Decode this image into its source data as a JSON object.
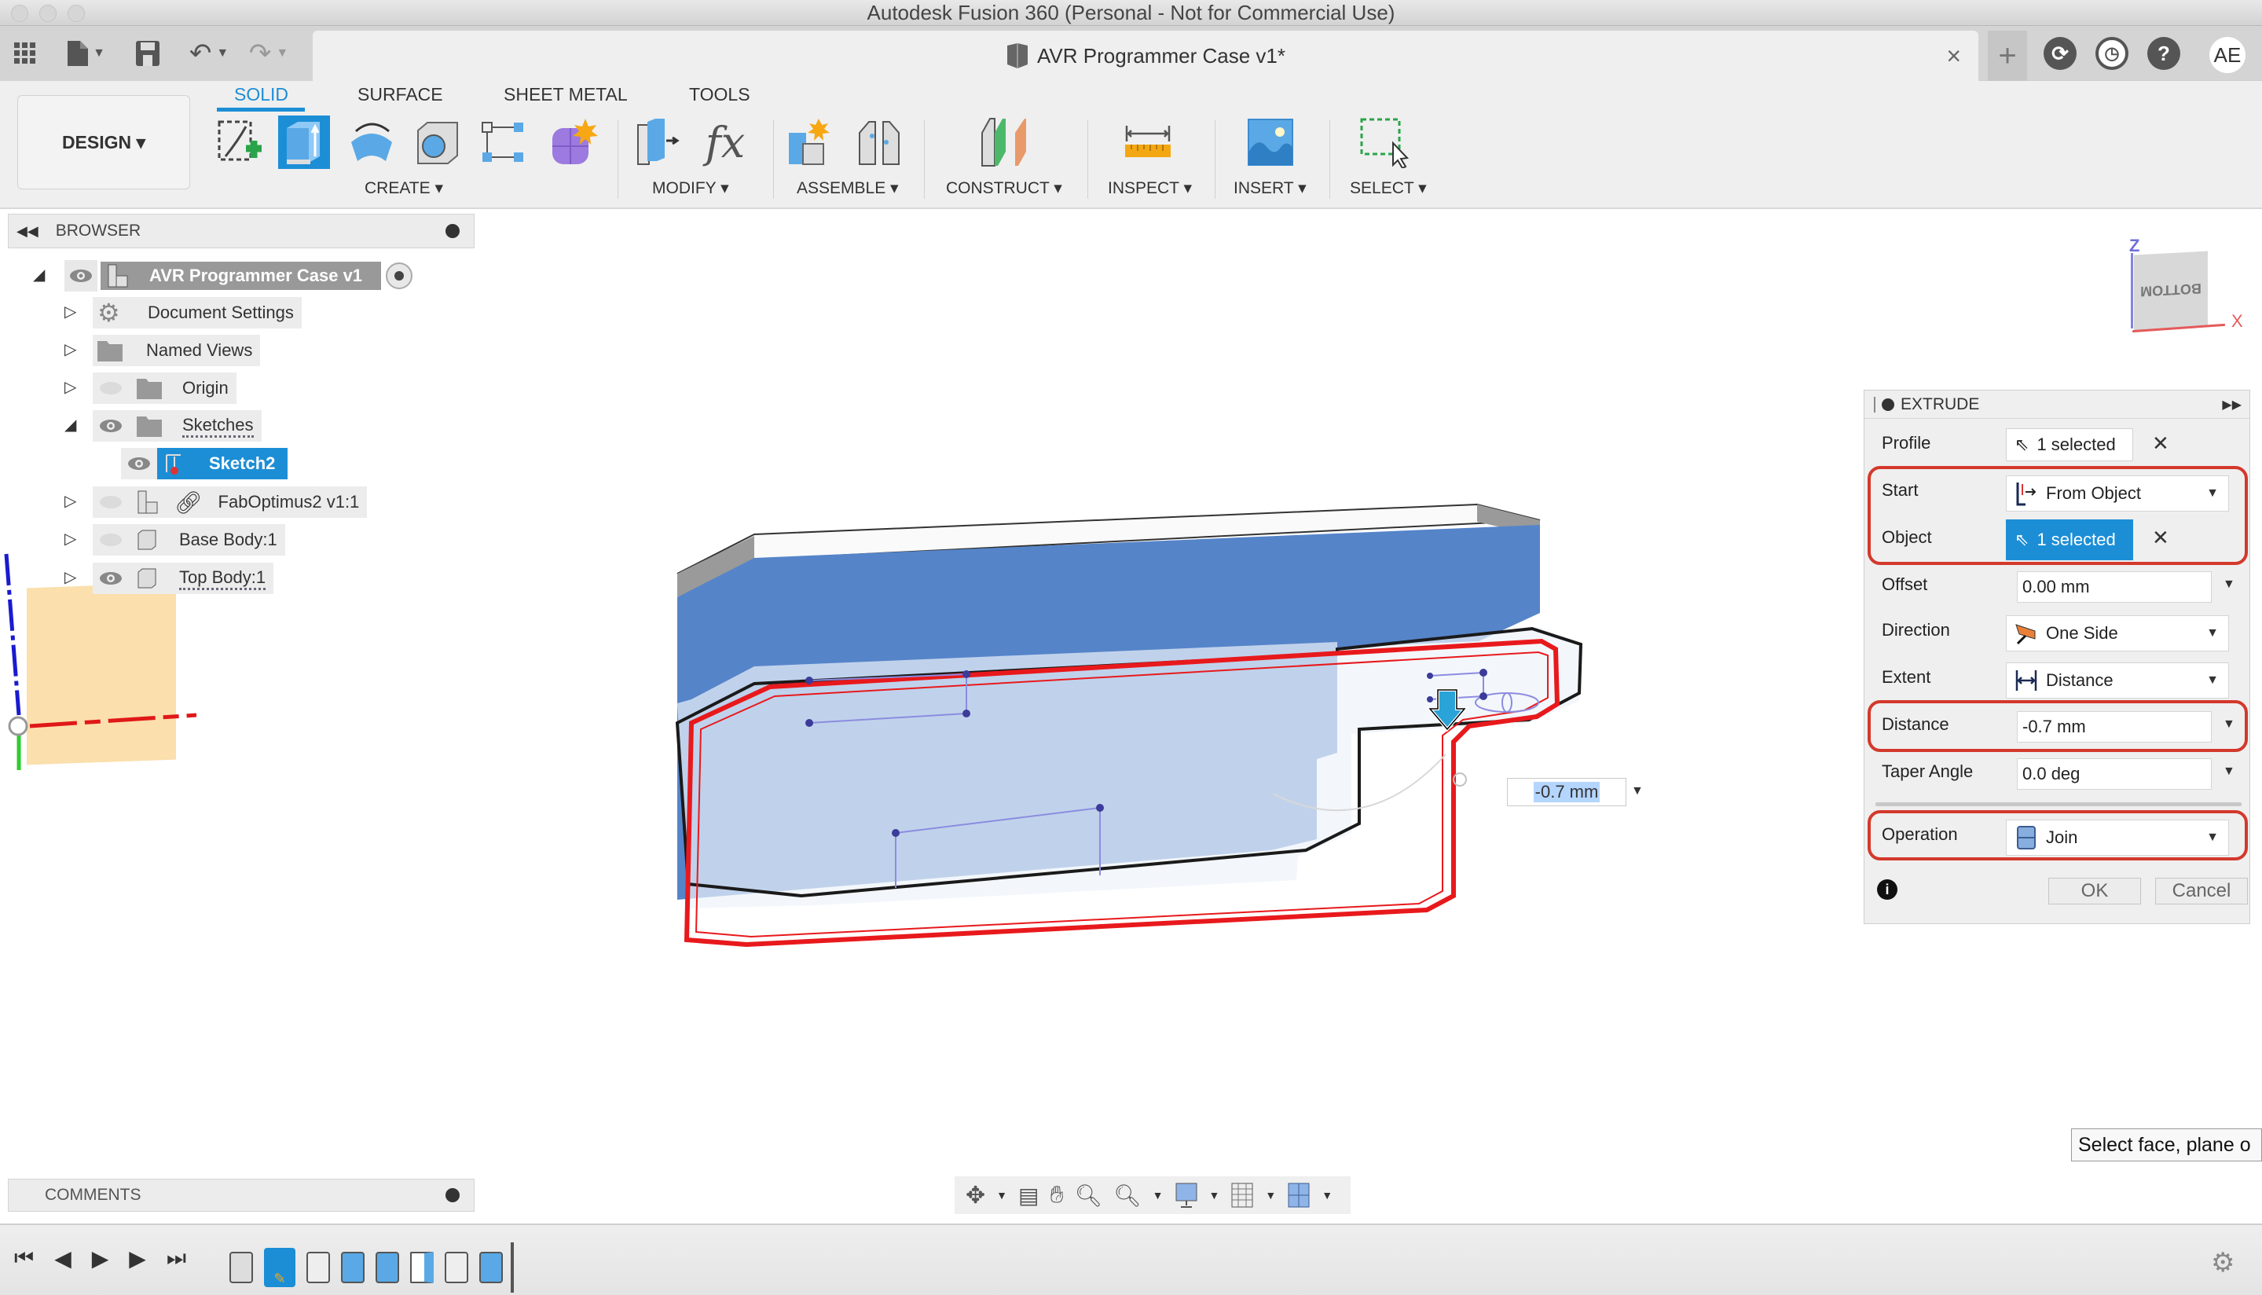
{
  "app": {
    "window_title": "Autodesk Fusion 360 (Personal - Not for Commercial Use)",
    "document_tab": "AVR Programmer Case v1*",
    "user_initials": "AE"
  },
  "quick_access": {
    "icons": [
      "grid-apps-icon",
      "file-icon",
      "save-icon",
      "undo-icon",
      "redo-icon"
    ]
  },
  "ribbon": {
    "workspace": "DESIGN ▾",
    "tabs": [
      {
        "label": "SOLID",
        "active": true
      },
      {
        "label": "SURFACE",
        "active": false
      },
      {
        "label": "SHEET METAL",
        "active": false
      },
      {
        "label": "TOOLS",
        "active": false
      }
    ],
    "groups": [
      {
        "label": "CREATE ▾"
      },
      {
        "label": "MODIFY ▾"
      },
      {
        "label": "ASSEMBLE ▾"
      },
      {
        "label": "CONSTRUCT ▾"
      },
      {
        "label": "INSPECT ▾"
      },
      {
        "label": "INSERT ▾"
      },
      {
        "label": "SELECT ▾"
      }
    ]
  },
  "browser": {
    "title": "BROWSER",
    "items": [
      {
        "label": "AVR Programmer Case v1",
        "level": 0,
        "expanded": true,
        "visible": true
      },
      {
        "label": "Document Settings",
        "level": 1,
        "expanded": false
      },
      {
        "label": "Named Views",
        "level": 1,
        "expanded": false
      },
      {
        "label": "Origin",
        "level": 1,
        "expanded": false,
        "visible": false
      },
      {
        "label": "Sketches",
        "level": 1,
        "expanded": true,
        "visible": true
      },
      {
        "label": "Sketch2",
        "level": 2,
        "selected": true,
        "visible": true
      },
      {
        "label": "FabOptimus2 v1:1",
        "level": 1,
        "expanded": false,
        "visible": false
      },
      {
        "label": "Base Body:1",
        "level": 1,
        "expanded": false,
        "visible": false
      },
      {
        "label": "Top Body:1",
        "level": 1,
        "expanded": false,
        "visible": true
      }
    ]
  },
  "viewcube": {
    "face": "BOTTOM",
    "axis_z": "Z",
    "axis_x": "X"
  },
  "viewport": {
    "dimension_value": "-0.7 mm",
    "tooltip": "Select face, plane o"
  },
  "extrude": {
    "title": "EXTRUDE",
    "rows": {
      "profile": {
        "label": "Profile",
        "value": "1 selected"
      },
      "start": {
        "label": "Start",
        "value": "From Object"
      },
      "object": {
        "label": "Object",
        "value": "1 selected"
      },
      "offset": {
        "label": "Offset",
        "value": "0.00 mm"
      },
      "direction": {
        "label": "Direction",
        "value": "One Side"
      },
      "extent": {
        "label": "Extent",
        "value": "Distance"
      },
      "distance": {
        "label": "Distance",
        "value": "-0.7 mm"
      },
      "taper": {
        "label": "Taper Angle",
        "value": "0.0 deg"
      },
      "operation": {
        "label": "Operation",
        "value": "Join"
      }
    },
    "ok": "OK",
    "cancel": "Cancel",
    "highlight_color": "#d3392b"
  },
  "comments": {
    "title": "COMMENTS"
  },
  "colors": {
    "accent": "#1c8ed6",
    "body_blue": "#5584c9",
    "profile_red": "#e8191c",
    "sketch_plane": "#fbdfac"
  }
}
